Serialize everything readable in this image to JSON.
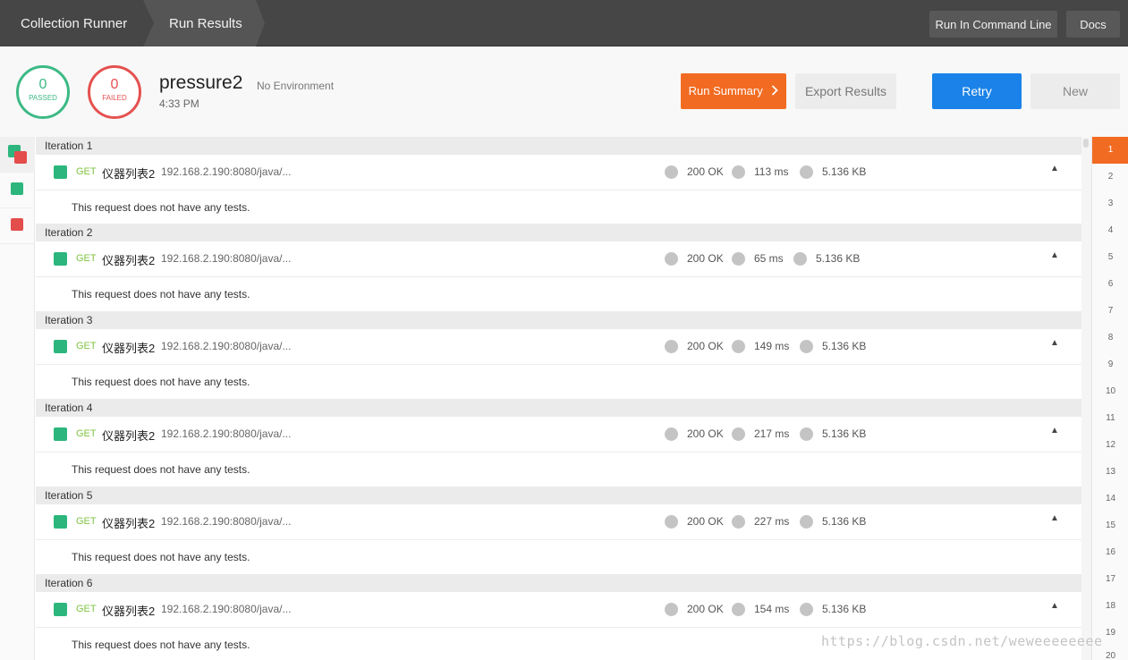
{
  "topbar": {
    "breadcrumbs": [
      "Collection Runner",
      "Run Results"
    ],
    "run_in_command_line": "Run In Command Line",
    "docs": "Docs"
  },
  "summary": {
    "passed_count": "0",
    "passed_label": "PASSED",
    "failed_count": "0",
    "failed_label": "FAILED",
    "run_name": "pressure2",
    "environment": "No Environment",
    "time": "4:33 PM",
    "run_summary": "Run Summary",
    "export_results": "Export Results",
    "retry": "Retry",
    "new": "New"
  },
  "iterations": [
    {
      "title": "Iteration 1",
      "method": "GET",
      "name": "仪器列表2",
      "url": "192.168.2.190:8080/java/...",
      "status": "200 OK",
      "time": "113 ms",
      "size": "5.136 KB",
      "tests": "This request does not have any tests."
    },
    {
      "title": "Iteration 2",
      "method": "GET",
      "name": "仪器列表2",
      "url": "192.168.2.190:8080/java/...",
      "status": "200 OK",
      "time": "65 ms",
      "size": "5.136 KB",
      "tests": "This request does not have any tests."
    },
    {
      "title": "Iteration 3",
      "method": "GET",
      "name": "仪器列表2",
      "url": "192.168.2.190:8080/java/...",
      "status": "200 OK",
      "time": "149 ms",
      "size": "5.136 KB",
      "tests": "This request does not have any tests."
    },
    {
      "title": "Iteration 4",
      "method": "GET",
      "name": "仪器列表2",
      "url": "192.168.2.190:8080/java/...",
      "status": "200 OK",
      "time": "217 ms",
      "size": "5.136 KB",
      "tests": "This request does not have any tests."
    },
    {
      "title": "Iteration 5",
      "method": "GET",
      "name": "仪器列表2",
      "url": "192.168.2.190:8080/java/...",
      "status": "200 OK",
      "time": "227 ms",
      "size": "5.136 KB",
      "tests": "This request does not have any tests."
    },
    {
      "title": "Iteration 6",
      "method": "GET",
      "name": "仪器列表2",
      "url": "192.168.2.190:8080/java/...",
      "status": "200 OK",
      "time": "154 ms",
      "size": "5.136 KB",
      "tests": "This request does not have any tests."
    }
  ],
  "iteration_index": [
    "1",
    "2",
    "3",
    "4",
    "5",
    "6",
    "7",
    "8",
    "9",
    "10",
    "11",
    "12",
    "13",
    "14",
    "15",
    "16",
    "17",
    "18",
    "19",
    "20"
  ],
  "active_iteration": "1",
  "watermark": "https://blog.csdn.net/weweeeeeeee",
  "colors": {
    "accent_orange": "#f26b22",
    "retry_blue": "#1a82e8",
    "pass_green": "#3cb985",
    "fail_red": "#e5514f"
  }
}
